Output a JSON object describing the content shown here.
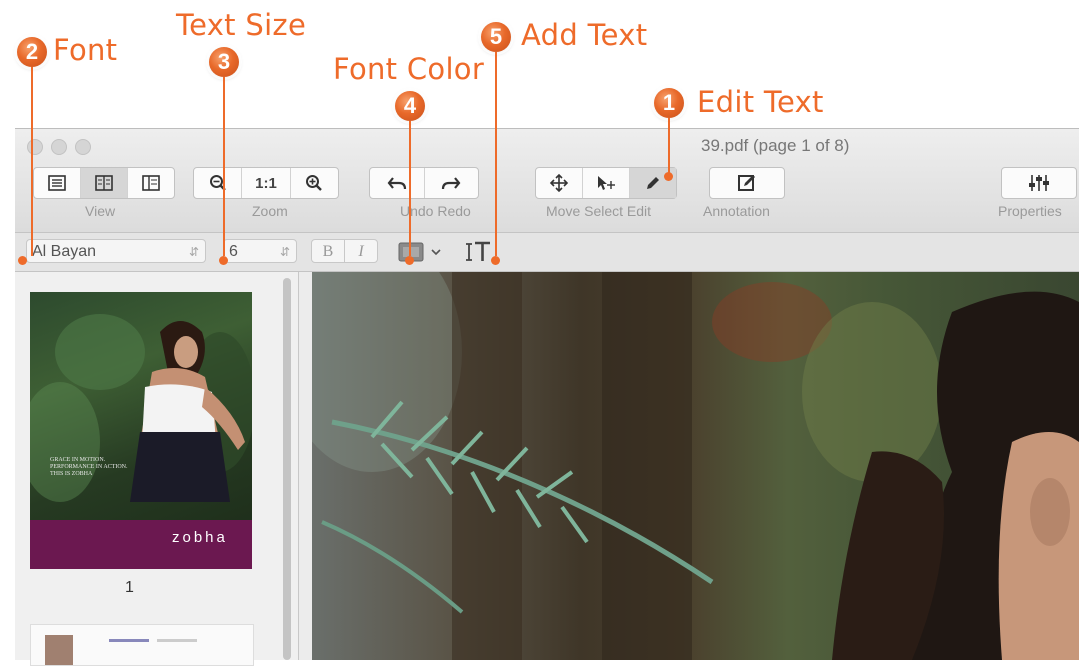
{
  "callouts": [
    {
      "number": "1",
      "label": "Edit Text"
    },
    {
      "number": "2",
      "label": "Font"
    },
    {
      "number": "3",
      "label": "Text Size"
    },
    {
      "number": "4",
      "label": "Font Color"
    },
    {
      "number": "5",
      "label": "Add Text"
    }
  ],
  "window": {
    "title": "39.pdf (page 1 of 8)"
  },
  "toolbar": {
    "view_label": "View",
    "zoom_label": "Zoom",
    "zoom_actual": "1:1",
    "undo_redo_label": "Undo Redo",
    "move_select_edit_label": "Move Select Edit",
    "annotation_label": "Annotation",
    "properties_label": "Properties"
  },
  "format": {
    "font_value": "Al Bayan",
    "size_value": "6",
    "bold": "B",
    "italic": "I"
  },
  "sidebar": {
    "page_number": "1",
    "thumb1": {
      "tagline": "GRACE IN MOTION. PERFORMANCE IN ACTION. THIS IS ZOBHA",
      "brand": "zobha"
    }
  },
  "colors": {
    "accent": "#ee6b2a"
  }
}
